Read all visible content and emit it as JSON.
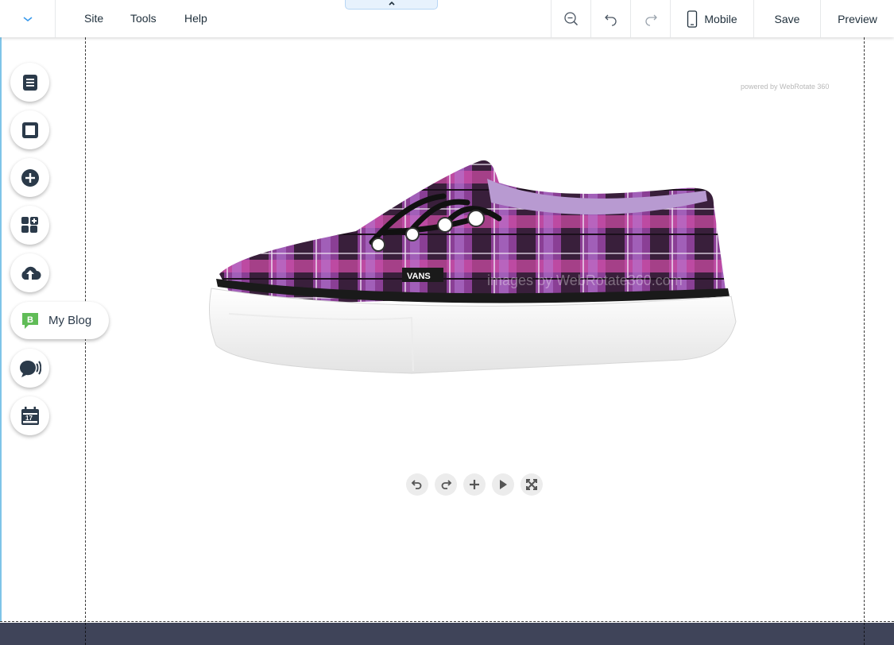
{
  "topbar": {
    "menu": [
      {
        "label": "Site"
      },
      {
        "label": "Tools"
      },
      {
        "label": "Help"
      }
    ],
    "actions": {
      "mobile_label": "Mobile",
      "save_label": "Save",
      "preview_label": "Preview"
    },
    "icons": {
      "menu_toggle": "chevron-down-icon",
      "collapse": "chevron-up-icon",
      "zoom_out": "zoom-out-icon",
      "undo": "undo-icon",
      "redo": "redo-icon",
      "mobile": "mobile-phone-icon"
    }
  },
  "left_rail": {
    "buttons": [
      {
        "icon": "pages-icon"
      },
      {
        "icon": "background-icon"
      },
      {
        "icon": "add-icon"
      },
      {
        "icon": "add-apps-icon"
      },
      {
        "icon": "upload-cloud-icon"
      },
      {
        "icon": "chat-icon"
      },
      {
        "icon": "calendar-icon"
      }
    ],
    "blog": {
      "badge_letter": "B",
      "label": "My Blog"
    }
  },
  "viewer": {
    "powered_by": "powered by WebRotate 360",
    "image_subject": "purple plaid Vans Authentic sneaker",
    "watermark": "images by WebRotate360.com",
    "brand_tag": "VANS",
    "controls": [
      "rotate-left-icon",
      "rotate-right-icon",
      "zoom-in-icon",
      "play-icon",
      "fullscreen-icon"
    ]
  },
  "colors": {
    "accent_blue": "#3899ec",
    "blog_green": "#60bc57",
    "icon_dark": "#2b3a4a",
    "footer": "#3f4459"
  }
}
